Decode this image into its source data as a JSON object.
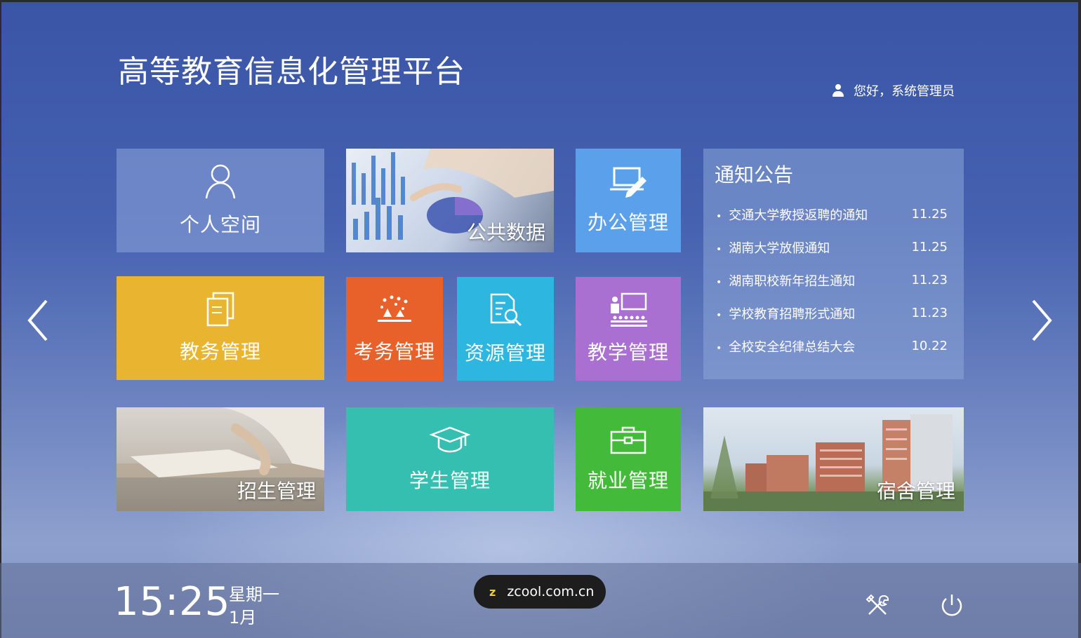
{
  "header": {
    "title": "高等教育信息化管理平台",
    "greeting": "您好，系统管理员",
    "user_icon": "user-icon"
  },
  "tiles": {
    "personal": {
      "label": "个人空间",
      "color": "#829bd4",
      "icon": "person-icon"
    },
    "public_data": {
      "label": "公共数据"
    },
    "office": {
      "label": "办公管理",
      "color": "#5aa0ea",
      "icon": "laptop-pen-icon"
    },
    "academic_affairs": {
      "label": "教务管理",
      "color": "#e9b42f",
      "icon": "documents-icon"
    },
    "exam": {
      "label": "考务管理",
      "color": "#e8602a",
      "icon": "exam-icon"
    },
    "resources": {
      "label": "资源管理",
      "color": "#2db6e0",
      "icon": "document-search-icon"
    },
    "teaching": {
      "label": "教学管理",
      "color": "#a970d1",
      "icon": "classroom-icon"
    },
    "enrollment": {
      "label": "招生管理"
    },
    "students": {
      "label": "学生管理",
      "color": "#35bfb0",
      "icon": "graduation-cap-icon"
    },
    "employment": {
      "label": "就业管理",
      "color": "#44ba3b",
      "icon": "briefcase-icon"
    },
    "dormitory": {
      "label": "宿舍管理"
    }
  },
  "notice": {
    "title": "通知公告",
    "items": [
      {
        "text": "交通大学教授返聘的通知",
        "date": "11.25"
      },
      {
        "text": "湖南大学放假通知",
        "date": "11.25"
      },
      {
        "text": "湖南职校新年招生通知",
        "date": "11.23"
      },
      {
        "text": "学校教育招聘形式通知",
        "date": "11.23"
      },
      {
        "text": "全校安全纪律总结大会",
        "date": "10.22"
      }
    ]
  },
  "nav": {
    "prev_icon": "chevron-left-icon",
    "next_icon": "chevron-right-icon"
  },
  "footer": {
    "time": "15:25",
    "weekday": "星期一",
    "month": "1月",
    "watermark_letter": "z",
    "watermark_text": "zcool.com.cn",
    "tools_icon": "tools-icon",
    "power_icon": "power-icon"
  }
}
